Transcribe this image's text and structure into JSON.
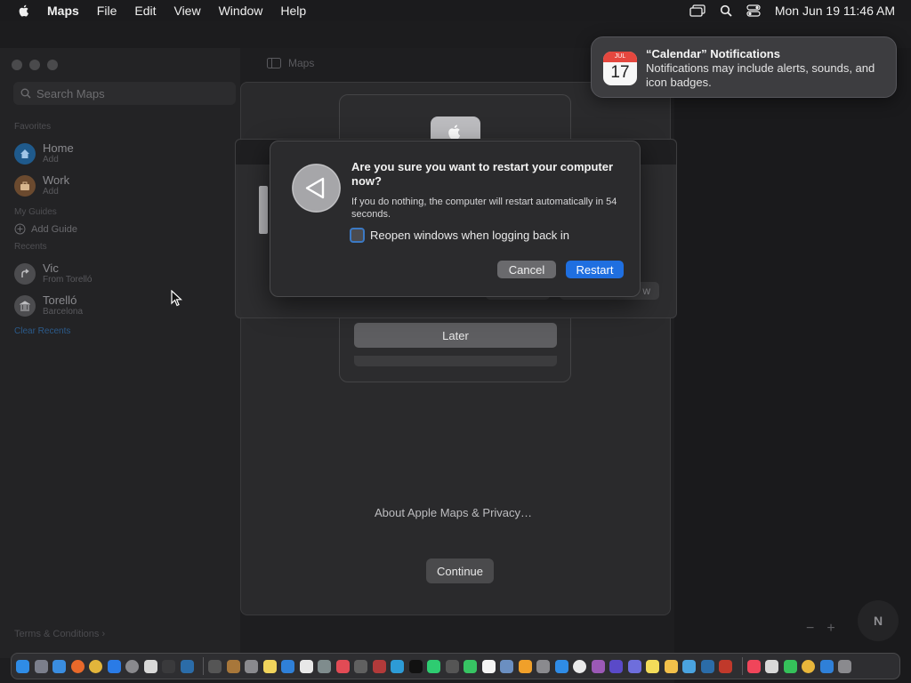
{
  "menubar": {
    "app_name": "Maps",
    "items": [
      "File",
      "Edit",
      "View",
      "Window",
      "Help"
    ],
    "clock": "Mon Jun 19  11:46 AM"
  },
  "maps": {
    "window_title": "Maps",
    "search_placeholder": "Search Maps",
    "favorites_label": "Favorites",
    "favorites": [
      {
        "title": "Home",
        "subtitle": "Add"
      },
      {
        "title": "Work",
        "subtitle": "Add"
      }
    ],
    "guides_label": "My Guides",
    "add_guide": "Add Guide",
    "recents_label": "Recents",
    "recents": [
      {
        "title": "Vic",
        "subtitle": "From Torelló"
      },
      {
        "title": "Torelló",
        "subtitle": "Barcelona"
      }
    ],
    "clear_recents": "Clear Recents",
    "terms": "Terms & Conditions",
    "about_link": "About Apple Maps & Privacy…",
    "continue_label": "Continue",
    "compass_label": "N",
    "zoom_out": "−",
    "zoom_in": "+"
  },
  "update_sheet": {
    "later_label": "Later"
  },
  "mid_sheet": {
    "ghost_button": "w"
  },
  "dialog": {
    "title": "Are you sure you want to restart your computer now?",
    "message": "If you do nothing, the computer will restart automatically in 54 seconds.",
    "checkbox_label": "Reopen windows when logging back in",
    "cancel_label": "Cancel",
    "restart_label": "Restart"
  },
  "notification": {
    "title": "“Calendar” Notifications",
    "body": "Notifications may include alerts, sounds, and icon badges.",
    "cal_month": "JUL",
    "cal_day": "17"
  },
  "colors": {
    "accent": "#1f6fe0",
    "background": "#1a1a1c"
  }
}
